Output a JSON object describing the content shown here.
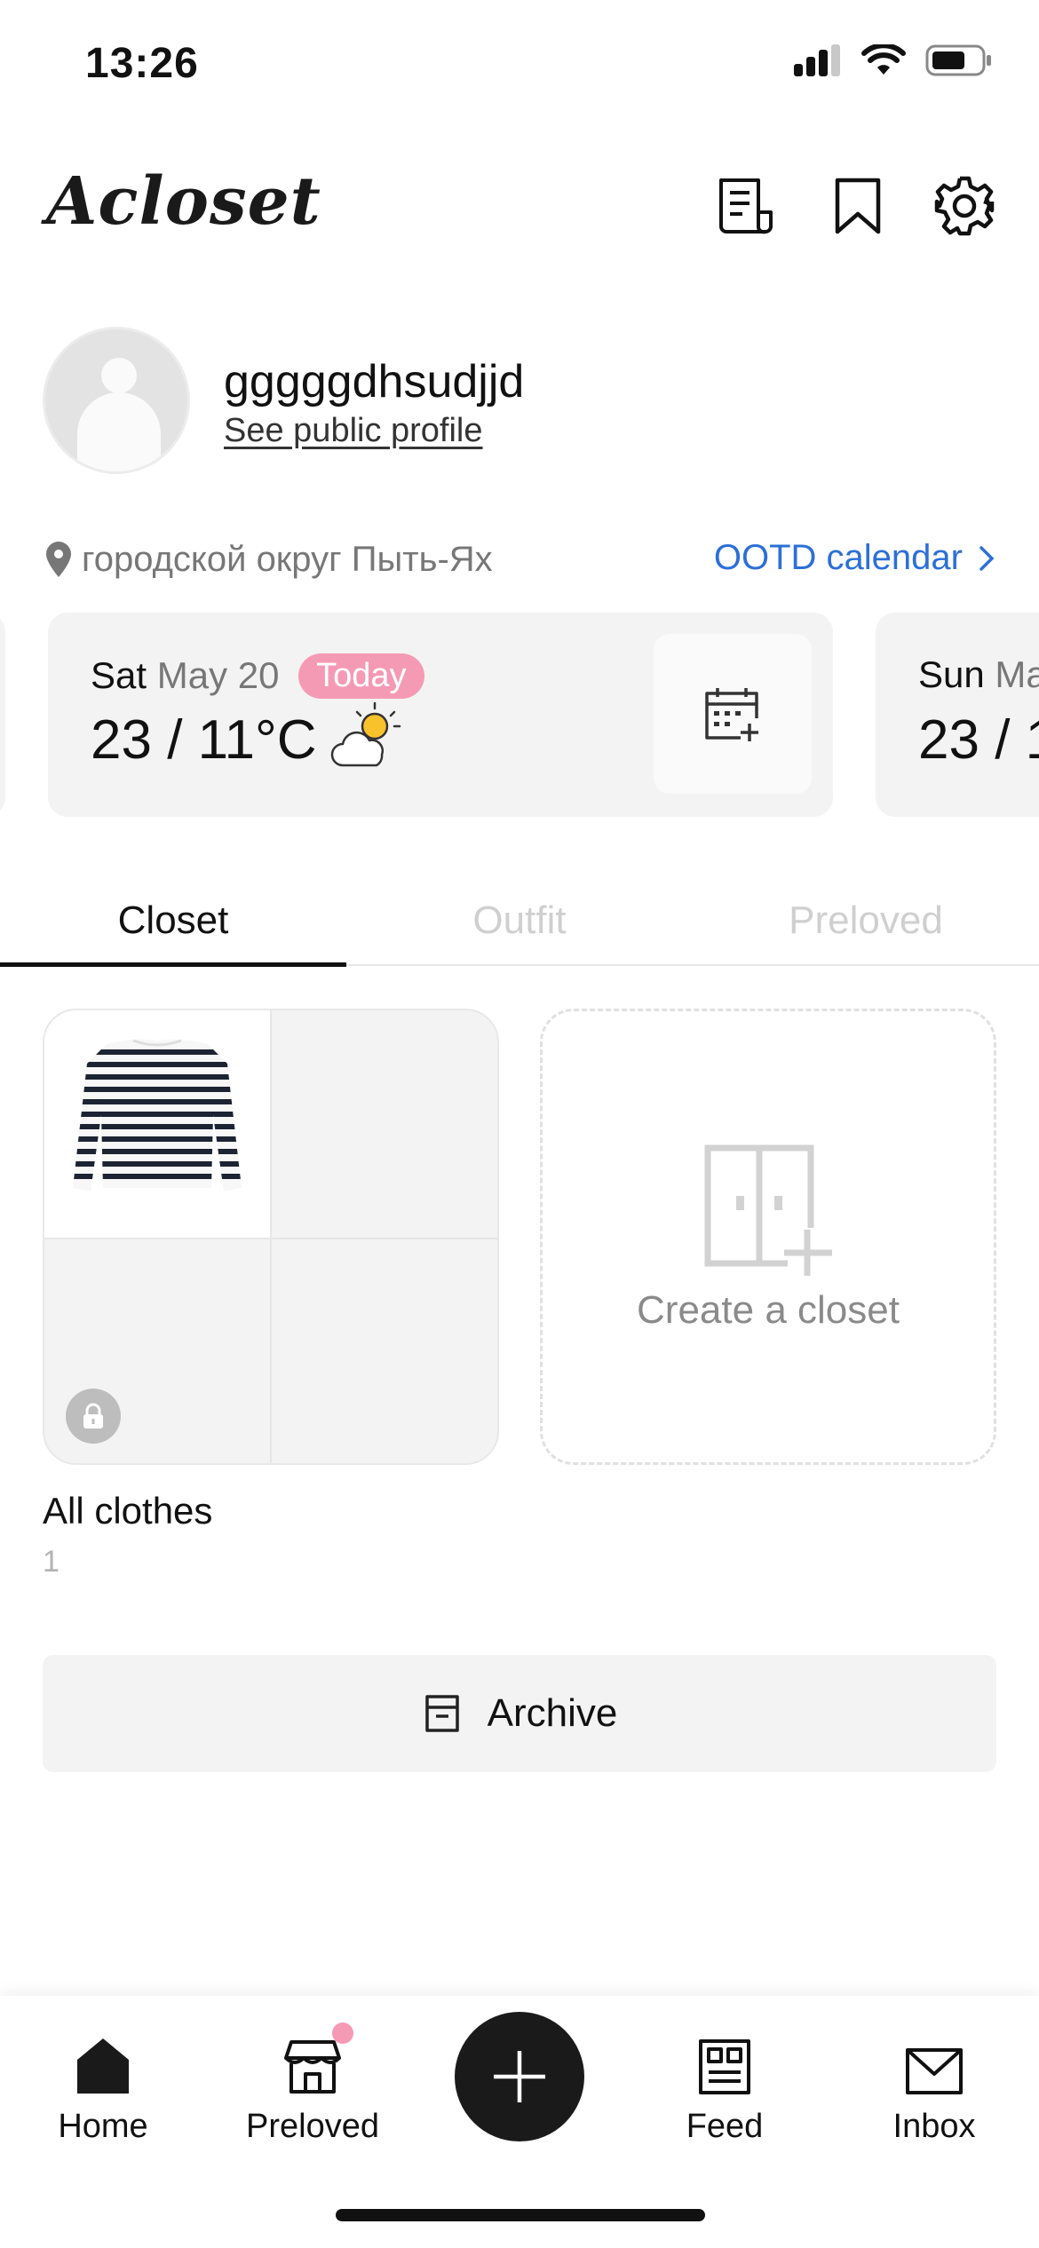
{
  "status_bar": {
    "time": "13:26",
    "icons": [
      "cellular-signal-icon",
      "wifi-icon",
      "battery-icon"
    ]
  },
  "header": {
    "logo": "Acloset",
    "buttons": [
      "notes-icon",
      "bookmark-icon",
      "settings-gear-icon"
    ]
  },
  "profile": {
    "username": "gggggdhsudjjd",
    "public_profile_link": "See public profile"
  },
  "location": {
    "text": "городской округ Пыть-Ях",
    "ootd_calendar_link": "OOTD calendar"
  },
  "weather": {
    "current": {
      "weekday": "Sat",
      "date": "May 20",
      "badge": "Today",
      "temperature": "23 / 11°C",
      "condition_icon": "partly-sunny-icon"
    },
    "next": {
      "weekday": "Sun",
      "date": "Ma",
      "temperature": "23 / 1"
    }
  },
  "tabs": [
    {
      "label": "Closet",
      "active": true
    },
    {
      "label": "Outfit",
      "active": false
    },
    {
      "label": "Preloved",
      "active": false
    }
  ],
  "closets": {
    "all_clothes": {
      "name": "All clothes",
      "count": "1",
      "locked": true
    },
    "create": {
      "label": "Create a closet"
    }
  },
  "archive": {
    "label": "Archive"
  },
  "bottom_nav": {
    "items": [
      {
        "label": "Home",
        "icon": "home-icon",
        "active": true
      },
      {
        "label": "Preloved",
        "icon": "shop-icon",
        "badge": true
      },
      {
        "label": "Feed",
        "icon": "feed-icon"
      },
      {
        "label": "Inbox",
        "icon": "mail-icon"
      }
    ],
    "center_button_icon": "plus-icon"
  },
  "colors": {
    "accent_blue": "#2c6fd8",
    "badge_pink": "#f59ab5",
    "card_bg": "#f3f3f3",
    "weather_sun": "#f8c22c"
  }
}
